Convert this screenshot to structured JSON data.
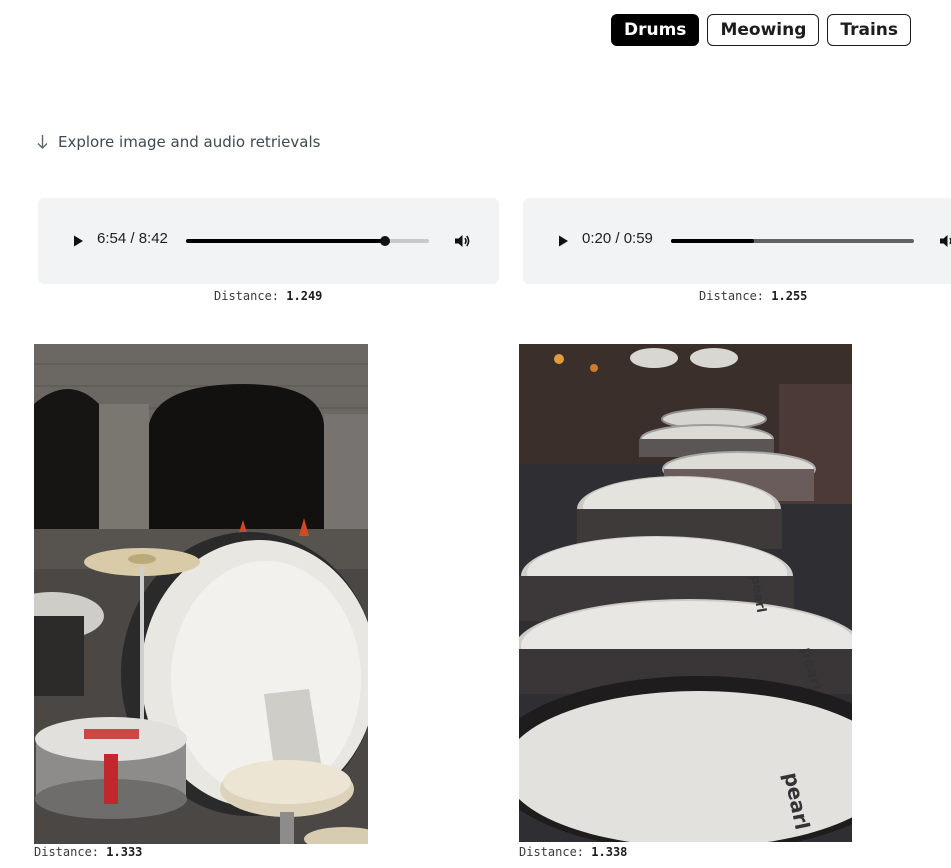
{
  "tabs": [
    {
      "label": "Drums",
      "active": true
    },
    {
      "label": "Meowing",
      "active": false
    },
    {
      "label": "Trains",
      "active": false
    }
  ],
  "explore_label": "Explore image and audio retrievals",
  "distance_label": "Distance:",
  "audio_results": [
    {
      "time": "6:54 / 8:42",
      "progress": 0.82,
      "distance": "1.249"
    },
    {
      "time": "0:20 / 0:59",
      "progress": 0.34,
      "distance": "1.255"
    }
  ],
  "image_results": [
    {
      "distance": "1.333"
    },
    {
      "distance": "1.338"
    }
  ],
  "icons": {
    "explore": "arrow-down-icon",
    "play": "play-icon",
    "volume": "volume-icon"
  }
}
